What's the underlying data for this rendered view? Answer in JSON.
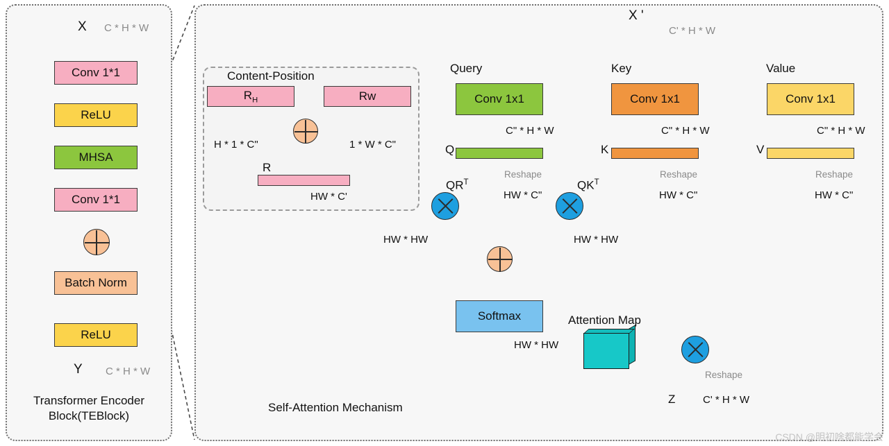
{
  "left_panel": {
    "input_label": "X",
    "input_dim": "C * H * W",
    "blocks": [
      {
        "label": "Conv 1*1",
        "color": "#f7aec1"
      },
      {
        "label": "ReLU",
        "color": "#fbd34b"
      },
      {
        "label": "MHSA",
        "color": "#8cc63e"
      },
      {
        "label": "Conv 1*1",
        "color": "#f7aec1"
      },
      {
        "label": "Batch Norm",
        "color": "#f8c196"
      },
      {
        "label": "ReLU",
        "color": "#fbd34b"
      }
    ],
    "output_label": "Y",
    "output_dim": "C * H * W",
    "caption_line1": "Transformer Encoder",
    "caption_line2": "Block(TEBlock)"
  },
  "right_panel": {
    "caption": "Self-Attention Mechanism",
    "input_label": "X '",
    "input_dim": "C' * H * W",
    "content_position": {
      "title": "Content-Position",
      "rh_label_main": "R",
      "rh_label_sub": "H",
      "rw_label": "Rw",
      "rh_dim": "H * 1 * C\"",
      "rw_dim": "1 * W * C\"",
      "r_label": "R",
      "r_dim": "HW * C'"
    },
    "branches": [
      {
        "name": "Query",
        "conv_label": "Conv 1x1",
        "conv_dim": "C\" * H * W",
        "out_label": "Q",
        "reshape_label": "Reshape",
        "reshape_dim": "HW * C\"",
        "color": "#8cc63e"
      },
      {
        "name": "Key",
        "conv_label": "Conv 1x1",
        "conv_dim": "C\" * H * W",
        "out_label": "K",
        "reshape_label": "Reshape",
        "reshape_dim": "HW * C\"",
        "color": "#f0953f"
      },
      {
        "name": "Value",
        "conv_label": "Conv 1x1",
        "conv_dim": "C\" * H * W",
        "out_label": "V",
        "reshape_label": "Reshape",
        "reshape_dim": "HW * C\"",
        "color": "#fbd667"
      }
    ],
    "qr_label_main": "QR",
    "qr_label_sup": "T",
    "qk_label_main": "QK",
    "qk_label_sup": "T",
    "qr_out_dim": "HW * HW",
    "qk_out_dim": "HW * HW",
    "softmax_label": "Softmax",
    "softmax_out_dim": "HW * HW",
    "attention_map_label": "Attention Map",
    "z_label": "Z",
    "z_reshape_label": "Reshape",
    "z_dim": "C' * H * W"
  },
  "watermark": "CSDN @明初啥都能学会"
}
